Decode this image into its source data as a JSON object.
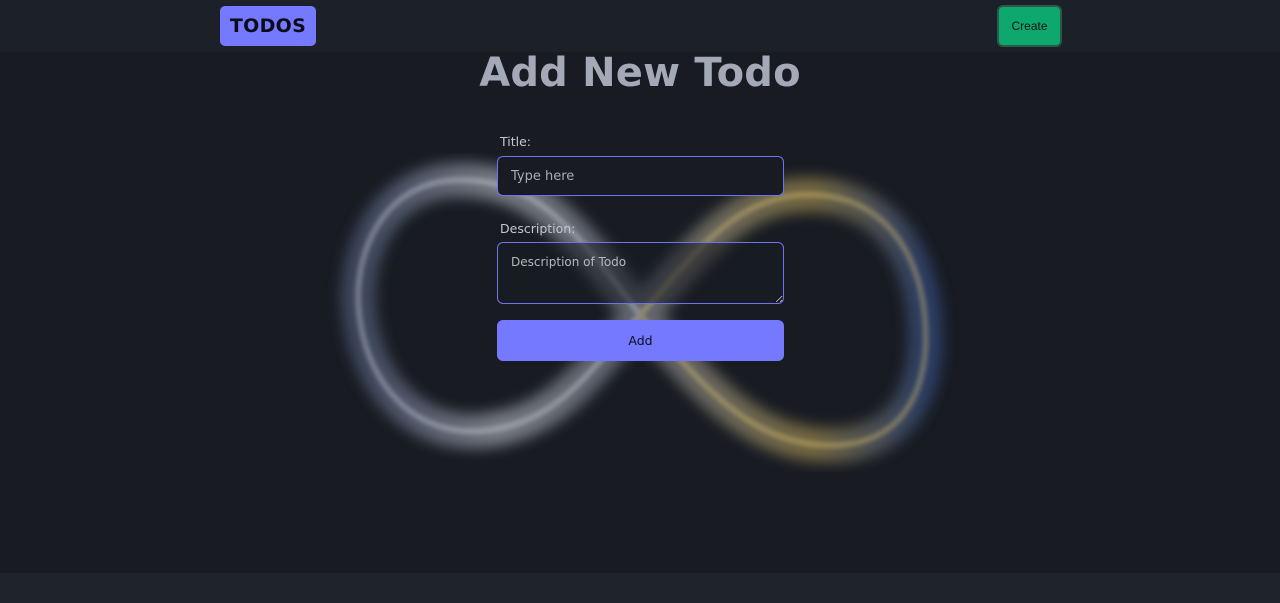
{
  "navbar": {
    "logo_text": "TODOS",
    "create_label": "Create"
  },
  "form": {
    "heading": "Add New Todo",
    "title_label": "Title:",
    "title_placeholder": "Type here",
    "title_value": "",
    "description_label": "Description:",
    "description_placeholder": "Description of Todo",
    "description_value": "",
    "submit_label": "Add"
  },
  "colors": {
    "background": "#181b22",
    "navbar": "#1c2029",
    "accent": "#7479fd",
    "create_button": "#0ea86e",
    "title_text": "#a3a9b7"
  },
  "decorations": {
    "background_icon": "infinity-symbol"
  }
}
